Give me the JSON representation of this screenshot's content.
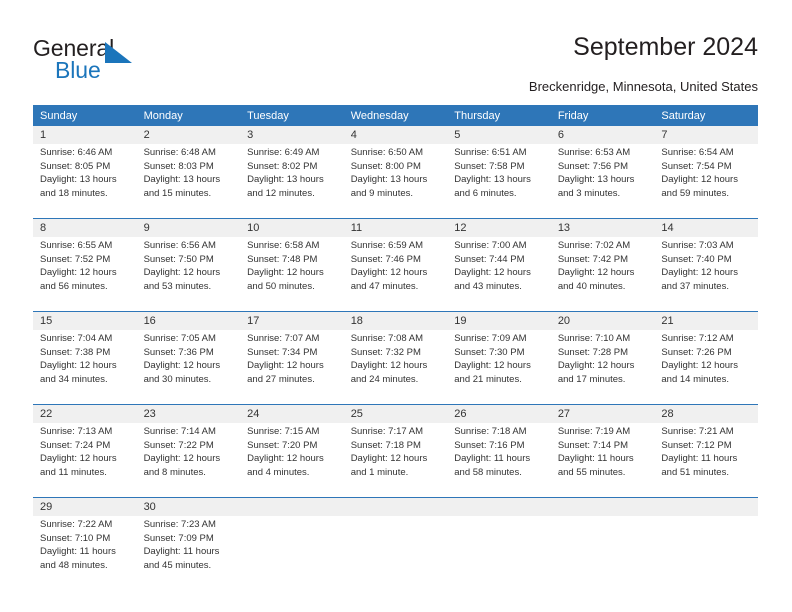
{
  "logo": {
    "word_top": "General",
    "word_bottom": "Blue",
    "triangle_color": "#1b75bb",
    "text_color": "#231f20"
  },
  "header": {
    "title": "September 2024",
    "subtitle": "Breckenridge, Minnesota, United States"
  },
  "theme": {
    "header_blue": "#2e76b8",
    "daynum_gray": "#f0f0f0",
    "text_dark": "#333333"
  },
  "calendar": {
    "weekday_headers": [
      "Sunday",
      "Monday",
      "Tuesday",
      "Wednesday",
      "Thursday",
      "Friday",
      "Saturday"
    ],
    "weeks": [
      {
        "days": [
          {
            "num": "1",
            "sunrise": "Sunrise: 6:46 AM",
            "sunset": "Sunset: 8:05 PM",
            "daylight1": "Daylight: 13 hours",
            "daylight2": "and 18 minutes."
          },
          {
            "num": "2",
            "sunrise": "Sunrise: 6:48 AM",
            "sunset": "Sunset: 8:03 PM",
            "daylight1": "Daylight: 13 hours",
            "daylight2": "and 15 minutes."
          },
          {
            "num": "3",
            "sunrise": "Sunrise: 6:49 AM",
            "sunset": "Sunset: 8:02 PM",
            "daylight1": "Daylight: 13 hours",
            "daylight2": "and 12 minutes."
          },
          {
            "num": "4",
            "sunrise": "Sunrise: 6:50 AM",
            "sunset": "Sunset: 8:00 PM",
            "daylight1": "Daylight: 13 hours",
            "daylight2": "and 9 minutes."
          },
          {
            "num": "5",
            "sunrise": "Sunrise: 6:51 AM",
            "sunset": "Sunset: 7:58 PM",
            "daylight1": "Daylight: 13 hours",
            "daylight2": "and 6 minutes."
          },
          {
            "num": "6",
            "sunrise": "Sunrise: 6:53 AM",
            "sunset": "Sunset: 7:56 PM",
            "daylight1": "Daylight: 13 hours",
            "daylight2": "and 3 minutes."
          },
          {
            "num": "7",
            "sunrise": "Sunrise: 6:54 AM",
            "sunset": "Sunset: 7:54 PM",
            "daylight1": "Daylight: 12 hours",
            "daylight2": "and 59 minutes."
          }
        ]
      },
      {
        "days": [
          {
            "num": "8",
            "sunrise": "Sunrise: 6:55 AM",
            "sunset": "Sunset: 7:52 PM",
            "daylight1": "Daylight: 12 hours",
            "daylight2": "and 56 minutes."
          },
          {
            "num": "9",
            "sunrise": "Sunrise: 6:56 AM",
            "sunset": "Sunset: 7:50 PM",
            "daylight1": "Daylight: 12 hours",
            "daylight2": "and 53 minutes."
          },
          {
            "num": "10",
            "sunrise": "Sunrise: 6:58 AM",
            "sunset": "Sunset: 7:48 PM",
            "daylight1": "Daylight: 12 hours",
            "daylight2": "and 50 minutes."
          },
          {
            "num": "11",
            "sunrise": "Sunrise: 6:59 AM",
            "sunset": "Sunset: 7:46 PM",
            "daylight1": "Daylight: 12 hours",
            "daylight2": "and 47 minutes."
          },
          {
            "num": "12",
            "sunrise": "Sunrise: 7:00 AM",
            "sunset": "Sunset: 7:44 PM",
            "daylight1": "Daylight: 12 hours",
            "daylight2": "and 43 minutes."
          },
          {
            "num": "13",
            "sunrise": "Sunrise: 7:02 AM",
            "sunset": "Sunset: 7:42 PM",
            "daylight1": "Daylight: 12 hours",
            "daylight2": "and 40 minutes."
          },
          {
            "num": "14",
            "sunrise": "Sunrise: 7:03 AM",
            "sunset": "Sunset: 7:40 PM",
            "daylight1": "Daylight: 12 hours",
            "daylight2": "and 37 minutes."
          }
        ]
      },
      {
        "days": [
          {
            "num": "15",
            "sunrise": "Sunrise: 7:04 AM",
            "sunset": "Sunset: 7:38 PM",
            "daylight1": "Daylight: 12 hours",
            "daylight2": "and 34 minutes."
          },
          {
            "num": "16",
            "sunrise": "Sunrise: 7:05 AM",
            "sunset": "Sunset: 7:36 PM",
            "daylight1": "Daylight: 12 hours",
            "daylight2": "and 30 minutes."
          },
          {
            "num": "17",
            "sunrise": "Sunrise: 7:07 AM",
            "sunset": "Sunset: 7:34 PM",
            "daylight1": "Daylight: 12 hours",
            "daylight2": "and 27 minutes."
          },
          {
            "num": "18",
            "sunrise": "Sunrise: 7:08 AM",
            "sunset": "Sunset: 7:32 PM",
            "daylight1": "Daylight: 12 hours",
            "daylight2": "and 24 minutes."
          },
          {
            "num": "19",
            "sunrise": "Sunrise: 7:09 AM",
            "sunset": "Sunset: 7:30 PM",
            "daylight1": "Daylight: 12 hours",
            "daylight2": "and 21 minutes."
          },
          {
            "num": "20",
            "sunrise": "Sunrise: 7:10 AM",
            "sunset": "Sunset: 7:28 PM",
            "daylight1": "Daylight: 12 hours",
            "daylight2": "and 17 minutes."
          },
          {
            "num": "21",
            "sunrise": "Sunrise: 7:12 AM",
            "sunset": "Sunset: 7:26 PM",
            "daylight1": "Daylight: 12 hours",
            "daylight2": "and 14 minutes."
          }
        ]
      },
      {
        "days": [
          {
            "num": "22",
            "sunrise": "Sunrise: 7:13 AM",
            "sunset": "Sunset: 7:24 PM",
            "daylight1": "Daylight: 12 hours",
            "daylight2": "and 11 minutes."
          },
          {
            "num": "23",
            "sunrise": "Sunrise: 7:14 AM",
            "sunset": "Sunset: 7:22 PM",
            "daylight1": "Daylight: 12 hours",
            "daylight2": "and 8 minutes."
          },
          {
            "num": "24",
            "sunrise": "Sunrise: 7:15 AM",
            "sunset": "Sunset: 7:20 PM",
            "daylight1": "Daylight: 12 hours",
            "daylight2": "and 4 minutes."
          },
          {
            "num": "25",
            "sunrise": "Sunrise: 7:17 AM",
            "sunset": "Sunset: 7:18 PM",
            "daylight1": "Daylight: 12 hours",
            "daylight2": "and 1 minute."
          },
          {
            "num": "26",
            "sunrise": "Sunrise: 7:18 AM",
            "sunset": "Sunset: 7:16 PM",
            "daylight1": "Daylight: 11 hours",
            "daylight2": "and 58 minutes."
          },
          {
            "num": "27",
            "sunrise": "Sunrise: 7:19 AM",
            "sunset": "Sunset: 7:14 PM",
            "daylight1": "Daylight: 11 hours",
            "daylight2": "and 55 minutes."
          },
          {
            "num": "28",
            "sunrise": "Sunrise: 7:21 AM",
            "sunset": "Sunset: 7:12 PM",
            "daylight1": "Daylight: 11 hours",
            "daylight2": "and 51 minutes."
          }
        ]
      },
      {
        "days": [
          {
            "num": "29",
            "sunrise": "Sunrise: 7:22 AM",
            "sunset": "Sunset: 7:10 PM",
            "daylight1": "Daylight: 11 hours",
            "daylight2": "and 48 minutes."
          },
          {
            "num": "30",
            "sunrise": "Sunrise: 7:23 AM",
            "sunset": "Sunset: 7:09 PM",
            "daylight1": "Daylight: 11 hours",
            "daylight2": "and 45 minutes."
          },
          {
            "num": "",
            "sunrise": "",
            "sunset": "",
            "daylight1": "",
            "daylight2": ""
          },
          {
            "num": "",
            "sunrise": "",
            "sunset": "",
            "daylight1": "",
            "daylight2": ""
          },
          {
            "num": "",
            "sunrise": "",
            "sunset": "",
            "daylight1": "",
            "daylight2": ""
          },
          {
            "num": "",
            "sunrise": "",
            "sunset": "",
            "daylight1": "",
            "daylight2": ""
          },
          {
            "num": "",
            "sunrise": "",
            "sunset": "",
            "daylight1": "",
            "daylight2": ""
          }
        ]
      }
    ]
  }
}
